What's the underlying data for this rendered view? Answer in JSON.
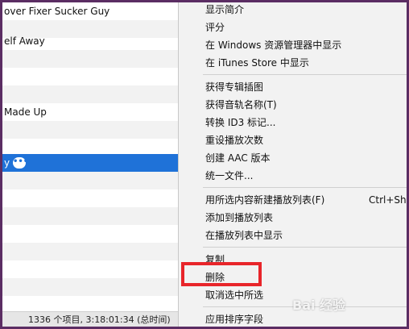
{
  "song_list": {
    "rows": [
      {
        "text": "over Fixer Sucker Guy"
      },
      {
        "text": ""
      },
      {
        "text": "elf Away"
      },
      {
        "text": ""
      },
      {
        "text": ""
      },
      {
        "text": ""
      },
      {
        "text": " Made Up"
      },
      {
        "text": ""
      },
      {
        "text": ""
      },
      {
        "text": "y"
      },
      {
        "text": ""
      },
      {
        "text": ""
      },
      {
        "text": ""
      },
      {
        "text": ""
      },
      {
        "text": ""
      },
      {
        "text": ""
      },
      {
        "text": ""
      }
    ],
    "selected_more_glyph": "•••"
  },
  "status_bar": {
    "text": "1336 个项目, 3:18:01:34 (总时间)"
  },
  "context_menu": {
    "items": [
      {
        "label": "显示简介"
      },
      {
        "label": "评分"
      },
      {
        "label": "在 Windows 资源管理器中显示"
      },
      {
        "label": "在 iTunes Store 中显示"
      },
      {
        "label": "获得专辑插图"
      },
      {
        "label": "获得音轨名称(T)"
      },
      {
        "label": "转换 ID3 标记..."
      },
      {
        "label": "重设播放次数"
      },
      {
        "label": "创建 AAC 版本"
      },
      {
        "label": "统一文件..."
      },
      {
        "label": "用所选内容新建播放列表(F)",
        "shortcut": "Ctrl+Shift"
      },
      {
        "label": "添加到播放列表"
      },
      {
        "label": "在播放列表中显示"
      },
      {
        "label": "复制"
      },
      {
        "label": "删除"
      },
      {
        "label": "取消选中所选"
      },
      {
        "label": "应用排序字段"
      }
    ]
  },
  "watermark": "Bai 经验",
  "colors": {
    "selection": "#1f72d8",
    "highlight_box": "#e8252a",
    "border": "#5b2d63"
  }
}
